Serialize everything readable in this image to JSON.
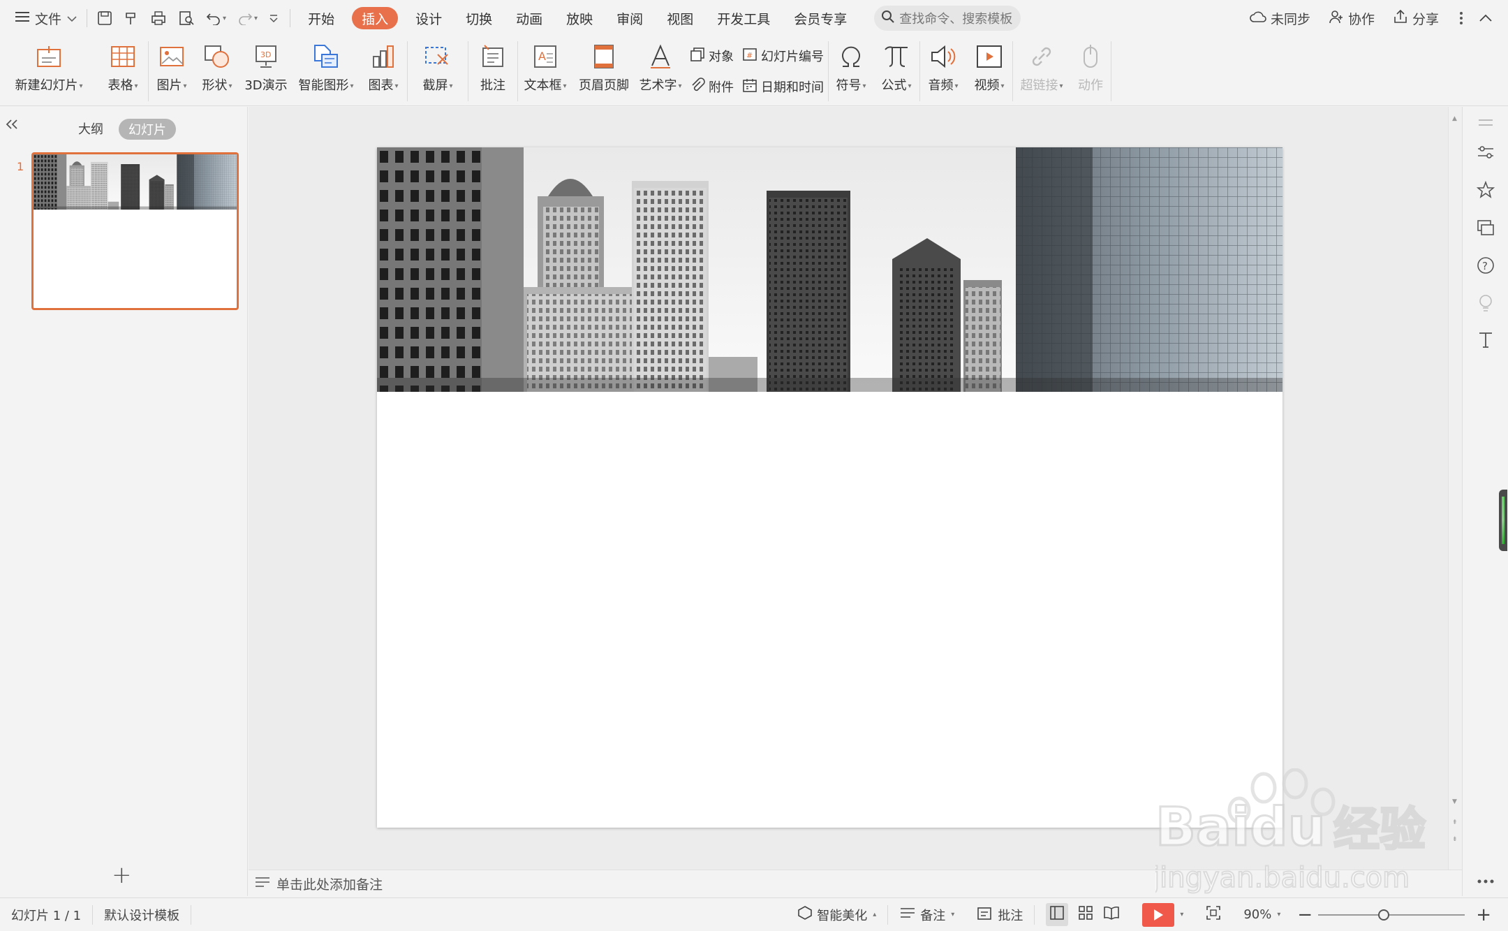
{
  "titlebar": {
    "file_menu": "文件",
    "tabs": [
      "开始",
      "插入",
      "设计",
      "切换",
      "动画",
      "放映",
      "审阅",
      "视图",
      "开发工具",
      "会员专享"
    ],
    "active_tab": "插入",
    "search_placeholder": "查找命令、搜索模板",
    "sync": "未同步",
    "collab": "协作",
    "share": "分享"
  },
  "ribbon": {
    "new_slide": "新建幻灯片",
    "table": "表格",
    "picture": "图片",
    "shape": "形状",
    "demo3d": "3D演示",
    "smartart": "智能图形",
    "chart": "图表",
    "screenshot": "截屏",
    "comment": "批注",
    "textbox": "文本框",
    "header_footer": "页眉页脚",
    "wordart": "艺术字",
    "object": "对象",
    "attachment": "附件",
    "slide_number": "幻灯片编号",
    "date_time": "日期和时间",
    "symbol": "符号",
    "formula": "公式",
    "audio": "音频",
    "video": "视频",
    "hyperlink": "超链接",
    "action": "动作"
  },
  "left_pane": {
    "tab_outline": "大纲",
    "tab_slides": "幻灯片",
    "slide_number": "1"
  },
  "notes_placeholder": "单击此处添加备注",
  "statusbar": {
    "slide_info": "幻灯片 1 / 1",
    "template": "默认设计模板",
    "smart_beautify": "智能美化",
    "notes": "备注",
    "comments": "批注",
    "zoom": "90%"
  },
  "watermark": {
    "brand": "Baidu",
    "cn": "经验",
    "url": "jingyan.baidu.com"
  },
  "colors": {
    "accent": "#e8704a",
    "play": "#f0584a"
  }
}
